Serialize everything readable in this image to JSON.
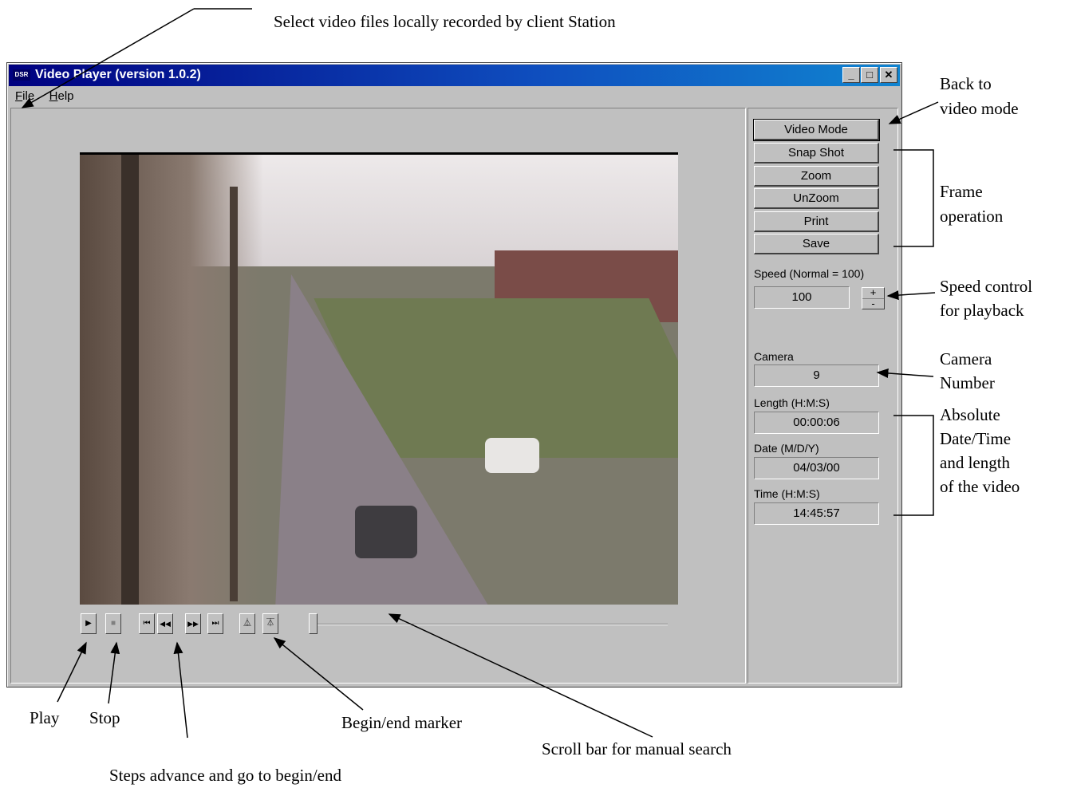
{
  "annotations": {
    "select_files": "Select video files locally recorded by client Station",
    "back_to_video_1": "Back to",
    "back_to_video_2": "video mode",
    "frame_op_1": "Frame",
    "frame_op_2": "operation",
    "speed_ctrl_1": "Speed control",
    "speed_ctrl_2": "for playback",
    "camera_num_1": "Camera",
    "camera_num_2": "Number",
    "abs_1": "Absolute",
    "abs_2": "Date/Time",
    "abs_3": "and length",
    "abs_4": "of the video",
    "play": "Play",
    "stop": "Stop",
    "begin_end_marker": "Begin/end marker",
    "scroll_bar": "Scroll bar for manual search",
    "steps": "Steps advance and go to begin/end"
  },
  "window": {
    "icon_text": "DSR",
    "title": "Video Player (version 1.0.2)",
    "minimize": "_",
    "maximize": "□",
    "close": "✕"
  },
  "menu": {
    "file_accel": "F",
    "file_rest": "ile",
    "help_accel": "H",
    "help_rest": "elp"
  },
  "panel": {
    "buttons": [
      "Video Mode",
      "Snap Shot",
      "Zoom",
      "UnZoom",
      "Print",
      "Save"
    ],
    "speed_label": "Speed (Normal = 100)",
    "speed_value": "100",
    "spin_plus": "+",
    "spin_minus": "-",
    "camera_label": "Camera",
    "camera_value": "9",
    "length_label": "Length (H:M:S)",
    "length_value": "00:00:06",
    "date_label": "Date (M/D/Y)",
    "date_value": "04/03/00",
    "time_label": "Time (H:M:S)",
    "time_value": "14:45:57"
  },
  "controls": {
    "play": "▶",
    "stop": "■",
    "goto_begin": "⏮",
    "step_back": "◀◀",
    "step_forward": "▶▶",
    "goto_end": "⏭",
    "begin_marker": "⏅",
    "end_marker": "⏄",
    "scroll_position": 0
  }
}
